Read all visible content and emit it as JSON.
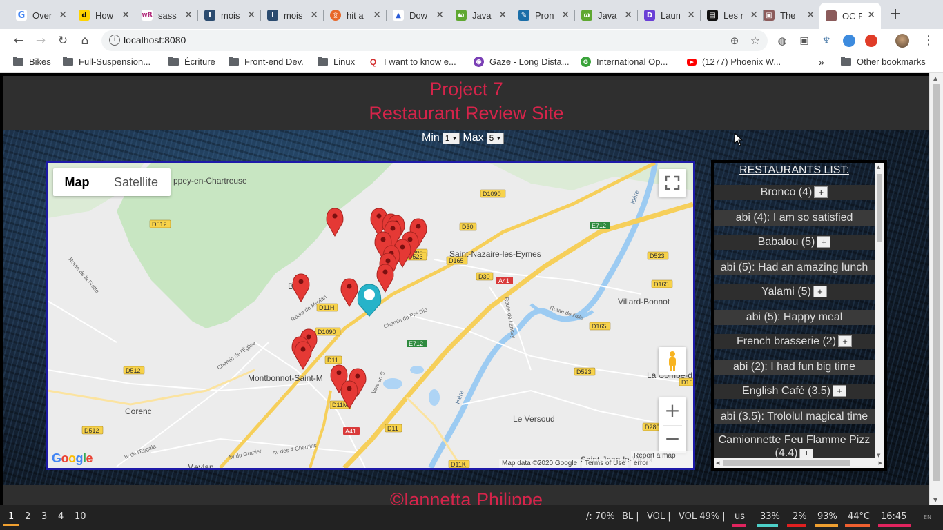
{
  "browser": {
    "tabs": [
      {
        "title": "Overview",
        "fav_color": "#ffffff",
        "fav_text": "G",
        "fav_fg": "#4285f4"
      },
      {
        "title": "How",
        "fav_color": "#111111",
        "fav_text": "d",
        "fav_fg": "#ffd400"
      },
      {
        "title": "sass",
        "fav_color": "#ffffff",
        "fav_text": "wR",
        "fav_fg": "#b02a7a"
      },
      {
        "title": "mois",
        "fav_color": "#2b4b6f",
        "fav_text": "I",
        "fav_fg": "#ffffff"
      },
      {
        "title": "mois",
        "fav_color": "#2b4b6f",
        "fav_text": "I",
        "fav_fg": "#ffffff"
      },
      {
        "title": "hit a",
        "fav_color": "#e8682a",
        "fav_text": "◎",
        "fav_fg": "#ffffff"
      },
      {
        "title": "Dow",
        "fav_color": "#ffffff",
        "fav_text": "▲",
        "fav_fg": "#2a5bd7"
      },
      {
        "title": "Java",
        "fav_color": "#5fa831",
        "fav_text": "ω",
        "fav_fg": "#ffffff"
      },
      {
        "title": "Pron",
        "fav_color": "#1b6ea8",
        "fav_text": "✎",
        "fav_fg": "#ffffff"
      },
      {
        "title": "Java",
        "fav_color": "#5fa831",
        "fav_text": "ω",
        "fav_fg": "#ffffff"
      },
      {
        "title": "Laun",
        "fav_color": "#6a3fd6",
        "fav_text": "D",
        "fav_fg": "#ffffff"
      },
      {
        "title": "Les r",
        "fav_color": "#111111",
        "fav_text": "▤",
        "fav_fg": "#ffffff"
      },
      {
        "title": "The",
        "fav_color": "#8b5b5b",
        "fav_text": "▣",
        "fav_fg": "#ffffff"
      },
      {
        "title": "OC P",
        "fav_color": "#8b5b5b",
        "fav_text": "",
        "fav_fg": "#ffffff"
      }
    ],
    "url": "localhost:8080",
    "bookmarks": [
      {
        "label": "Bikes",
        "type": "folder"
      },
      {
        "label": "Full-Suspension...",
        "type": "folder"
      },
      {
        "label": "Écriture",
        "type": "folder"
      },
      {
        "label": "Front-end Dev.",
        "type": "folder"
      },
      {
        "label": "Linux",
        "type": "folder"
      },
      {
        "label": "I want to know e...",
        "type": "site",
        "color": "#ffffff",
        "fg": "#d32f2f",
        "glyph": "Q"
      },
      {
        "label": "Gaze - Long Dista...",
        "type": "site",
        "color": "#7a3fb5",
        "fg": "#ffffff",
        "glyph": "◉"
      },
      {
        "label": "International Op...",
        "type": "site",
        "color": "#3aa33a",
        "fg": "#ffffff",
        "glyph": "G"
      },
      {
        "label": "(1277) Phoenix W...",
        "type": "site",
        "color": "#ff0000",
        "fg": "#ffffff",
        "glyph": "▶"
      }
    ],
    "more_bookmarks": "»",
    "other_bookmarks": "Other bookmarks"
  },
  "page": {
    "title_line1": "Project 7",
    "title_line2": "Restaurant Review Site",
    "filter": {
      "min_label": "Min",
      "min_value": "1",
      "max_label": "Max",
      "max_value": "5"
    },
    "footer": "©Iannetta Philippe"
  },
  "map": {
    "type_map": "Map",
    "type_satellite": "Satellite",
    "attribution": "Map data ©2020 Google",
    "terms": "Terms of Use",
    "report": "Report a map error",
    "zoom_in": "+",
    "zoom_out": "−",
    "places": {
      "saint_nazaire": "Saint-Nazaire-les-Eymes",
      "villard_bonnot": "Villard-Bonnot",
      "montbonnot": "Montbonnot-Saint-M",
      "corenc": "Corenc",
      "le_versoud": "Le Versoud",
      "meylan": "Meylan",
      "la_combe": "La Combe-d",
      "saint_jean": "Saint-Jean-le-Vieux",
      "biviers": "B    s",
      "ppey": "ppey-en-Chartreuse",
      "isere1": "Isère",
      "isere2": "Isère",
      "chemin_pre": "Chemin du Pré Dio",
      "route_lancey": "Route de Lancey",
      "route_isle": "Route de l'Isle",
      "route_meylan": "Route de Meylan",
      "chemin_eglise": "Chemin de l'Église",
      "voie": "Voie en S",
      "route_frette": "Route de la Frette",
      "av_eygala": "Av de l'Eygala",
      "av_granier": "Av du Granier",
      "av_chenes": "Av des 4 Chemins"
    },
    "roads": [
      "D512",
      "D1090",
      "D30",
      "E712",
      "D523",
      "D165",
      "A41",
      "D11H",
      "D1090",
      "D11",
      "D512",
      "D11M",
      "D11",
      "D523",
      "D280",
      "D165",
      "D11K",
      "D512",
      "D165",
      "D30",
      "A41",
      "E712",
      "D165",
      "D1090",
      "D523"
    ]
  },
  "restaurants": {
    "title": "RESTAURANTS LIST:",
    "items": [
      {
        "name": "Bronco (4)",
        "review": "abi (4): I am so satisfied"
      },
      {
        "name": "Babalou (5)",
        "review": "abi (5): Had an amazing lunch"
      },
      {
        "name": "Yalami (5)",
        "review": "abi (5): Happy meal"
      },
      {
        "name": "French brasserie (2)",
        "review": "abi (2): I had fun big time"
      },
      {
        "name": "English Café (3.5)",
        "review": "abi (3.5): Trololul magical time"
      },
      {
        "name": "Camionnette Feu Flamme Pizz",
        "name2": "(4.4)"
      }
    ],
    "add_label": "+"
  },
  "taskbar": {
    "workspaces": [
      "1",
      "2",
      "3",
      "4",
      "10"
    ],
    "status": [
      {
        "text": "/: 70%"
      },
      {
        "text": "BL |"
      },
      {
        "text": "VOL |"
      },
      {
        "text": "VOL 49% |"
      },
      {
        "text": "us"
      },
      {
        "text": "33%"
      },
      {
        "text": "2%"
      },
      {
        "text": "93%"
      },
      {
        "text": "44°C"
      },
      {
        "text": "16:45"
      },
      {
        "text": "EN"
      }
    ]
  },
  "colors": {
    "accent_red": "#d4244a",
    "map_border": "#1d19a8",
    "marker_red": "#e53935",
    "marker_cyan": "#26b3c9"
  }
}
